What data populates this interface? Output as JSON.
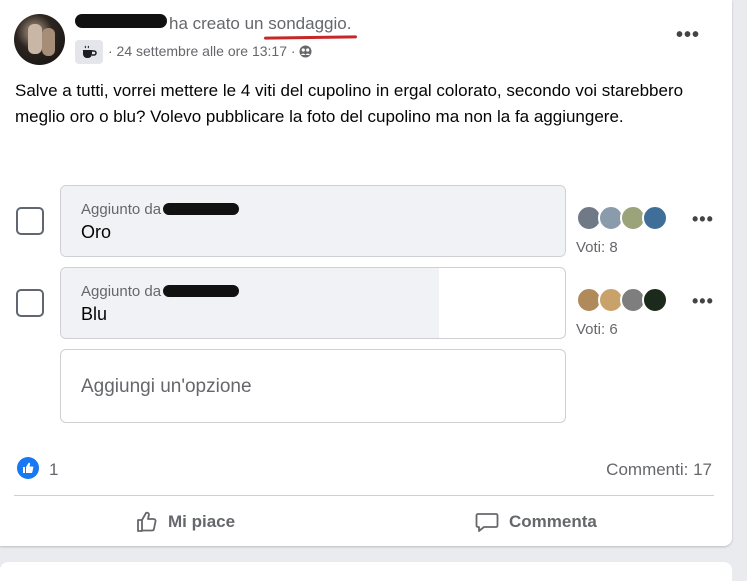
{
  "post": {
    "header_action": "ha creato un ",
    "header_object": "sondaggio.",
    "group_badge_icon": "coffee-cup-icon",
    "meta": "· 24 settembre alle ore 13:17 ·",
    "privacy_icon": "group-privacy-icon",
    "more_label": "•••",
    "text": "Salve a tutti, vorrei mettere le 4 viti del cupolino in ergal colorato, secondo voi starebbero meglio oro o blu? Volevo pubblicare la foto del cupolino ma non la fa aggiungere."
  },
  "poll": {
    "options": [
      {
        "added_by_label": "Aggiunto da",
        "label": "Oro",
        "votes_label": "Voti: 8",
        "votes": 8,
        "fill_fraction": 1.0,
        "more_label": "•••",
        "voter_colors": [
          "#6f7a86",
          "#8a9bab",
          "#9aa37a",
          "#3f6f99"
        ]
      },
      {
        "added_by_label": "Aggiunto da",
        "label": "Blu",
        "votes_label": "Voti: 6",
        "votes": 6,
        "fill_fraction": 0.75,
        "more_label": "•••",
        "voter_colors": [
          "#b08a5a",
          "#c9a26b",
          "#7e7e7e",
          "#1c2a1c"
        ]
      }
    ],
    "add_option_placeholder": "Aggiungi un'opzione"
  },
  "reactions": {
    "like_count": "1",
    "comments": "Commenti: 17"
  },
  "actions": {
    "like_label": "Mi piace",
    "comment_label": "Commenta"
  },
  "colors": {
    "facebook_blue": "#1877f2",
    "annotation_red": "#c62828"
  }
}
